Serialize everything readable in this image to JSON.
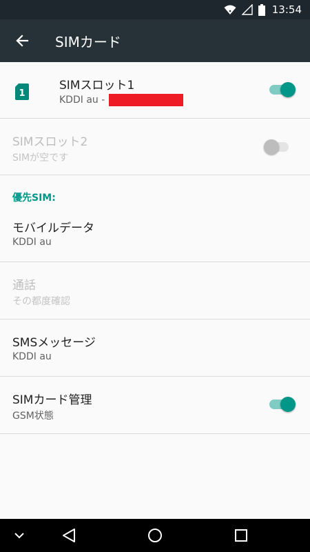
{
  "status_bar": {
    "time": "13:54"
  },
  "app_bar": {
    "title": "SIMカード"
  },
  "slot1": {
    "title": "SIMスロット1",
    "subtitle": "KDDI au -",
    "sim_number": "1",
    "enabled": true
  },
  "slot2": {
    "title": "SIMスロット2",
    "subtitle": "SIMが空です",
    "enabled": false
  },
  "preferred_header": "優先SIM:",
  "mobile_data": {
    "title": "モバイルデータ",
    "subtitle": "KDDI au"
  },
  "calls": {
    "title": "通話",
    "subtitle": "その都度確認"
  },
  "sms": {
    "title": "SMSメッセージ",
    "subtitle": "KDDI au"
  },
  "sim_management": {
    "title": "SIMカード管理",
    "subtitle": "GSM状態",
    "enabled": true
  },
  "colors": {
    "accent": "#009688",
    "app_bar": "#263238",
    "status_bar": "#1d272d"
  }
}
